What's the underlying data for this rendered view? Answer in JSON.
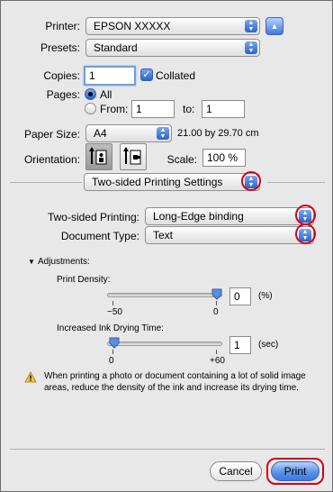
{
  "printer": {
    "label": "Printer:",
    "value": "EPSON XXXXX"
  },
  "presets": {
    "label": "Presets:",
    "value": "Standard"
  },
  "copies": {
    "label": "Copies:",
    "value": "1",
    "collated_label": "Collated",
    "collated_checked": true
  },
  "pages": {
    "label": "Pages:",
    "all_label": "All",
    "from_label": "From:",
    "from_value": "1",
    "to_label": "to:",
    "to_value": "1",
    "selected": "All"
  },
  "paper_size": {
    "label": "Paper Size:",
    "value": "A4",
    "dimensions": "21.00 by 29.70 cm"
  },
  "orientation": {
    "label": "Orientation:",
    "selected": "portrait"
  },
  "scale": {
    "label": "Scale:",
    "value": "100 %"
  },
  "section_menu": {
    "value": "Two-sided Printing Settings"
  },
  "two_sided_printing": {
    "label": "Two-sided Printing:",
    "value": "Long-Edge binding"
  },
  "document_type": {
    "label": "Document Type:",
    "value": "Text"
  },
  "adjustments": {
    "label": "Adjustments:",
    "print_density": {
      "label": "Print Density:",
      "value": "0",
      "unit": "(%)",
      "min_label": "−50",
      "max_label": "0",
      "min": -50,
      "max": 0,
      "level": 0
    },
    "drying_time": {
      "label": "Increased Ink Drying Time:",
      "value": "1",
      "unit": "(sec)",
      "min_label": "0",
      "max_label": "+60",
      "min": 0,
      "max": 60,
      "level": 1
    }
  },
  "warning": {
    "text": "When printing a photo or document containing a lot of solid image areas, reduce the density of the ink and increase its drying time."
  },
  "buttons": {
    "cancel": "Cancel",
    "print": "Print"
  },
  "colors": {
    "accent": "#3d78de",
    "highlight": "#d0021b"
  }
}
